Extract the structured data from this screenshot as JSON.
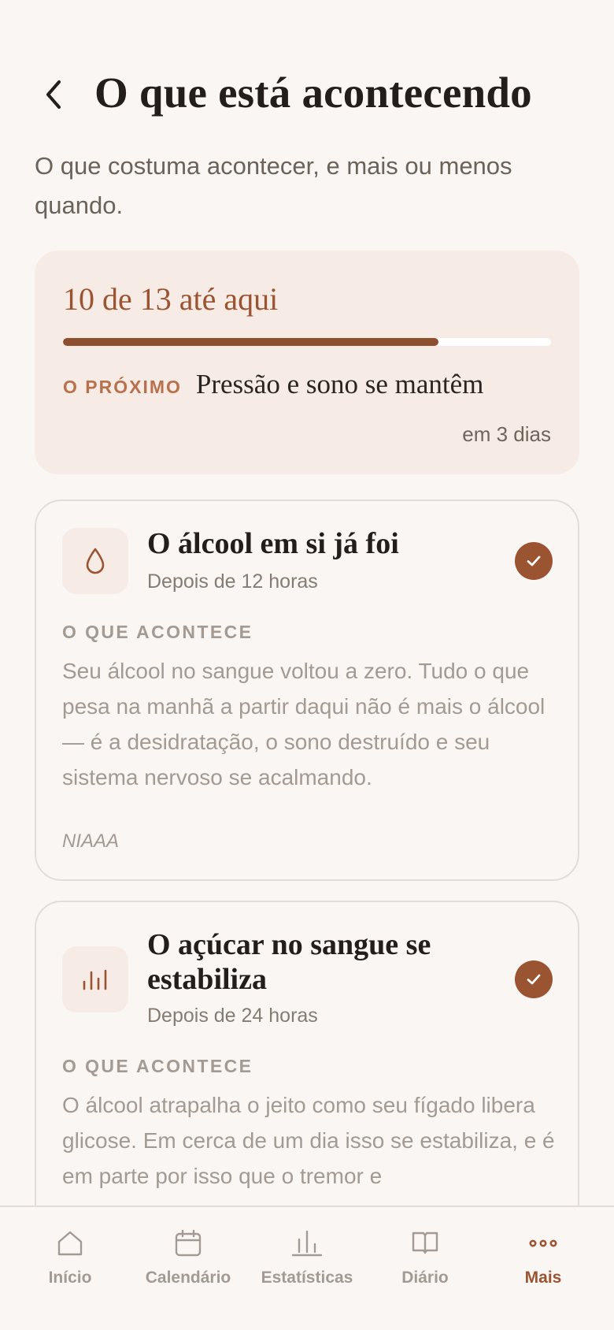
{
  "header": {
    "back_icon": "chevron-left-icon",
    "title": "O que está acontecendo",
    "subtitle": "O que costuma acontecer, e mais ou menos quando."
  },
  "progress": {
    "count_text": "10 de 13 até aqui",
    "completed": 10,
    "total": 13,
    "next_label": "O PRÓXIMO",
    "next_title": "Pressão e sono se mantêm",
    "next_when": "em 3 dias"
  },
  "milestones": [
    {
      "icon": "drop-icon",
      "title": "O álcool em si já foi",
      "time": "Depois de 12 horas",
      "completed": true,
      "section_label": "O QUE ACONTECE",
      "body": "Seu álcool no sangue voltou a zero. Tudo o que pesa na manhã a partir daqui não é mais o álcool — é a desidratação, o sono destruído e seu sistema nervoso se acalmando.",
      "source": "NIAAA"
    },
    {
      "icon": "levels-icon",
      "title": "O açúcar no sangue se estabiliza",
      "time": "Depois de 24 horas",
      "completed": true,
      "section_label": "O QUE ACONTECE",
      "body": "O álcool atrapalha o jeito como seu fígado libera glicose. Em cerca de um dia isso se estabiliza, e é em parte por isso que o tremor e"
    }
  ],
  "tabs": [
    {
      "label": "Início",
      "icon": "home-icon",
      "active": false
    },
    {
      "label": "Calendário",
      "icon": "calendar-icon",
      "active": false
    },
    {
      "label": "Estatísticas",
      "icon": "bar-chart-icon",
      "active": false
    },
    {
      "label": "Diário",
      "icon": "book-icon",
      "active": false
    },
    {
      "label": "Mais",
      "icon": "more-icon",
      "active": true
    }
  ],
  "colors": {
    "accent": "#9a5432",
    "background": "#f9f6f3",
    "card_tint": "#f6ebe5",
    "muted_text": "#a39b93"
  }
}
